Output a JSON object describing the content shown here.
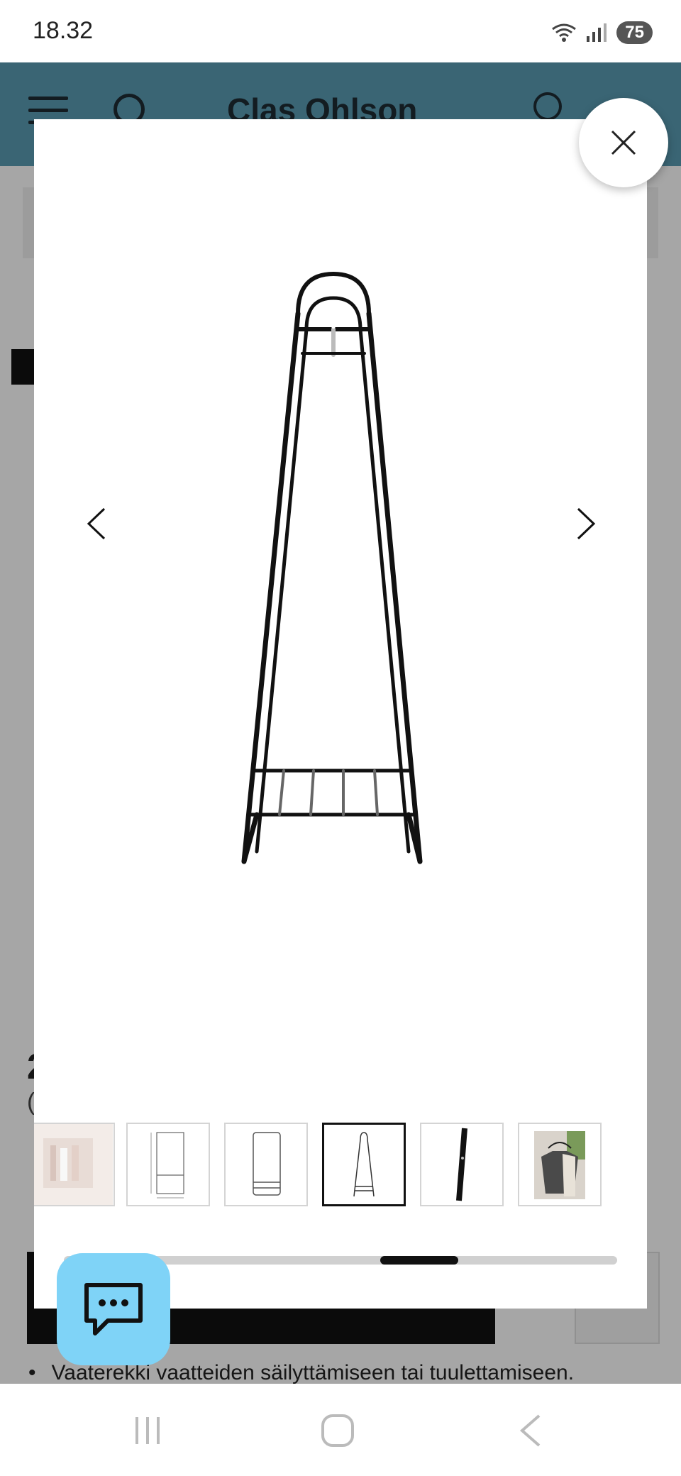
{
  "status_bar": {
    "time": "18.32",
    "battery": "75"
  },
  "header": {
    "logo_text": "Clas Ohlson"
  },
  "page": {
    "price_fragment": "2",
    "paren_fragment": "(",
    "bullet_text": "Vaaterekki vaatteiden säilyttämiseen tai tuulettamiseen."
  },
  "gallery": {
    "thumbnails": [
      {
        "name": "thumb-room-photo"
      },
      {
        "name": "thumb-dimension-drawing"
      },
      {
        "name": "thumb-side-view"
      },
      {
        "name": "thumb-front-view"
      },
      {
        "name": "thumb-detail-pole"
      },
      {
        "name": "thumb-hanging-clothes"
      }
    ],
    "selected_index": 3
  },
  "colors": {
    "header_bg": "#5a9bb3",
    "chat_button": "#7fd3f7",
    "selected_border": "#111111"
  },
  "icons": {
    "close": "close-icon",
    "prev": "chevron-left-icon",
    "next": "chevron-right-icon",
    "chat": "chat-bubble-icon"
  }
}
